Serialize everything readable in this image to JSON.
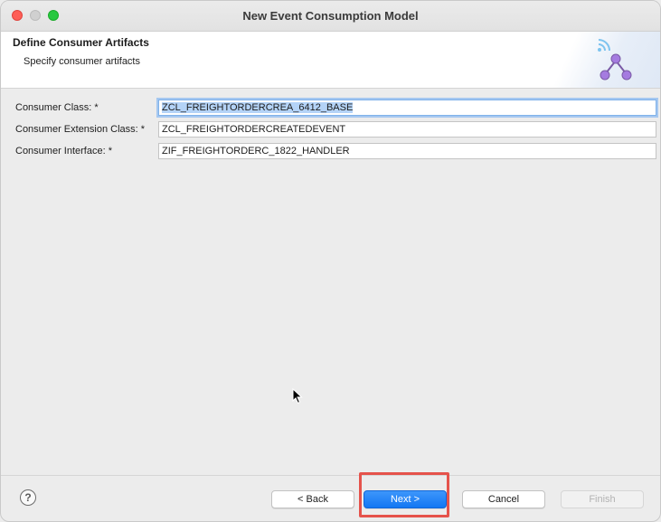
{
  "window": {
    "title": "New Event Consumption Model"
  },
  "header": {
    "title": "Define Consumer Artifacts",
    "subtitle": "Specify consumer artifacts",
    "icon": "wizard-graph-icon"
  },
  "form": {
    "consumer_class": {
      "label": "Consumer Class: *",
      "value": "ZCL_FREIGHTORDERCREA_6412_BASE"
    },
    "consumer_extension_class": {
      "label": "Consumer Extension Class: *",
      "value": "ZCL_FREIGHTORDERCREATEDEVENT"
    },
    "consumer_interface": {
      "label": "Consumer Interface: *",
      "value": "ZIF_FREIGHTORDERC_1822_HANDLER"
    }
  },
  "buttons": {
    "help": "?",
    "back": "< Back",
    "next": "Next >",
    "cancel": "Cancel",
    "finish": "Finish"
  },
  "colors": {
    "accent": "#1a7cf5",
    "highlight": "#e5534b",
    "selection": "#b4d3f7",
    "icon": "#9b6ad6"
  }
}
